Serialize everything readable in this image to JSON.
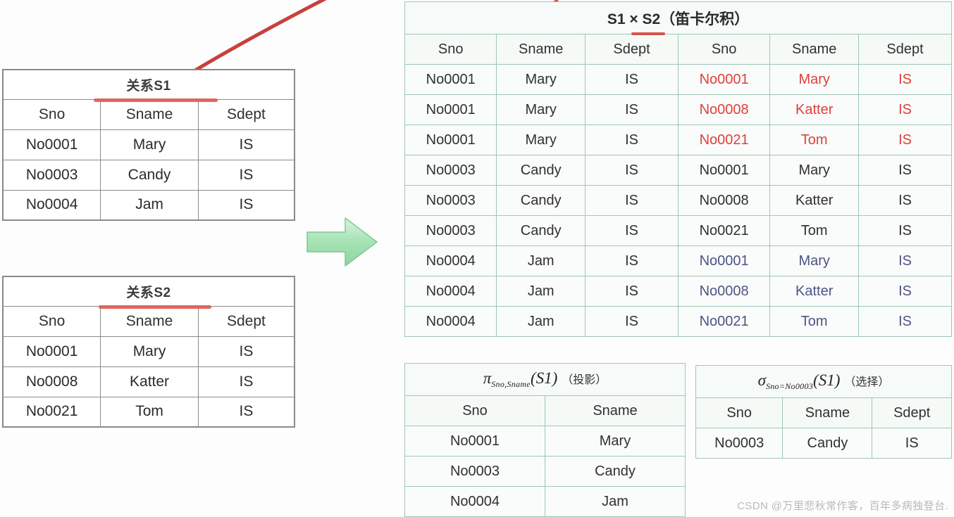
{
  "relation_s1": {
    "caption": "关系S1",
    "headers": [
      "Sno",
      "Sname",
      "Sdept"
    ],
    "rows": [
      [
        "No0001",
        "Mary",
        "IS"
      ],
      [
        "No0003",
        "Candy",
        "IS"
      ],
      [
        "No0004",
        "Jam",
        "IS"
      ]
    ]
  },
  "relation_s2": {
    "caption": "关系S2",
    "headers": [
      "Sno",
      "Sname",
      "Sdept"
    ],
    "rows": [
      [
        "No0001",
        "Mary",
        "IS"
      ],
      [
        "No0008",
        "Katter",
        "IS"
      ],
      [
        "No0021",
        "Tom",
        "IS"
      ]
    ]
  },
  "cartesian_product": {
    "caption_expr": "S1 × S2",
    "caption_note": "（笛卡尔积）",
    "headers": [
      "Sno",
      "Sname",
      "Sdept",
      "Sno",
      "Sname",
      "Sdept"
    ],
    "rows": [
      {
        "left": [
          "No0001",
          "Mary",
          "IS"
        ],
        "right": [
          "No0001",
          "Mary",
          "IS"
        ],
        "right_color": "red"
      },
      {
        "left": [
          "No0001",
          "Mary",
          "IS"
        ],
        "right": [
          "No0008",
          "Katter",
          "IS"
        ],
        "right_color": "red"
      },
      {
        "left": [
          "No0001",
          "Mary",
          "IS"
        ],
        "right": [
          "No0021",
          "Tom",
          "IS"
        ],
        "right_color": "red"
      },
      {
        "left": [
          "No0003",
          "Candy",
          "IS"
        ],
        "right": [
          "No0001",
          "Mary",
          "IS"
        ],
        "right_color": "black"
      },
      {
        "left": [
          "No0003",
          "Candy",
          "IS"
        ],
        "right": [
          "No0008",
          "Katter",
          "IS"
        ],
        "right_color": "black"
      },
      {
        "left": [
          "No0003",
          "Candy",
          "IS"
        ],
        "right": [
          "No0021",
          "Tom",
          "IS"
        ],
        "right_color": "black"
      },
      {
        "left": [
          "No0004",
          "Jam",
          "IS"
        ],
        "right": [
          "No0001",
          "Mary",
          "IS"
        ],
        "right_color": "blue"
      },
      {
        "left": [
          "No0004",
          "Jam",
          "IS"
        ],
        "right": [
          "No0008",
          "Katter",
          "IS"
        ],
        "right_color": "blue"
      },
      {
        "left": [
          "No0004",
          "Jam",
          "IS"
        ],
        "right": [
          "No0021",
          "Tom",
          "IS"
        ],
        "right_color": "blue"
      }
    ]
  },
  "projection": {
    "operator": "π",
    "subscript": "Sno,Sname",
    "argument": "(S1)",
    "note": "（投影）",
    "headers": [
      "Sno",
      "Sname"
    ],
    "rows": [
      [
        "No0001",
        "Mary"
      ],
      [
        "No0003",
        "Candy"
      ],
      [
        "No0004",
        "Jam"
      ]
    ]
  },
  "selection": {
    "operator": "σ",
    "subscript": "Sno=No0003",
    "argument": "(S1)",
    "note": "（选择）",
    "headers": [
      "Sno",
      "Sname",
      "Sdept"
    ],
    "rows": [
      [
        "No0003",
        "Candy",
        "IS"
      ]
    ]
  },
  "watermark": "CSDN @万里悲秋常作客，百年多病独登台.",
  "colors": {
    "red_text": "#e0403a",
    "blue_text": "#4e5484",
    "green_border": "#9ec7b5",
    "gray_border": "#8a8a8a",
    "red_pen": "#d9453f",
    "green_arrow_light": "#cdf0d3",
    "green_arrow_dark": "#8fd6a2"
  }
}
